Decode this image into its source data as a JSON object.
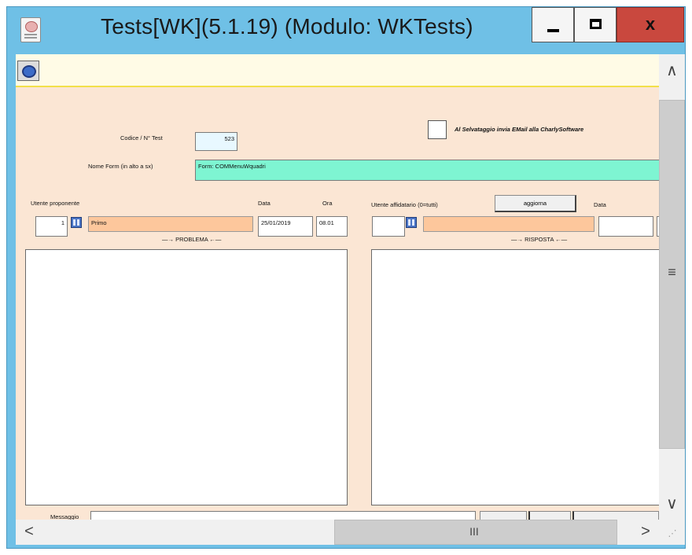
{
  "window": {
    "title": "Tests[WK](5.1.19) (Modulo: WKTests)",
    "close_glyph": "x",
    "frame_color": "#6fc0e6",
    "close_color": "#c9483e"
  },
  "form": {
    "codice_label": "Codice / N° Test",
    "codice_value": "523",
    "checkbox_label": "Al Selvataggio invia EMail alla CharlySoftware",
    "nome_form_label": "Nome Form (in alto a sx)",
    "nome_form_value": "Form: COMMenuWquadri",
    "background_color": "#fbe6d4"
  },
  "problema": {
    "utente_label": "Utente proponente",
    "data_label": "Data",
    "ora_label": "Ora",
    "utente_id": "1",
    "utente_name": "Primo",
    "data_value": "25/01/2019",
    "ora_value": "08.01",
    "section_label": "—→ PROBLEMA ←—"
  },
  "risposta": {
    "utente_label": "Utente affidatario (0=tutti)",
    "aggiorna_button": "aggiorna",
    "data_label": "Data",
    "section_label": "—→ RISPOSTA ←—"
  },
  "bottom": {
    "label": "Messaggio"
  },
  "scrollbars": {
    "up_glyph": "∧",
    "down_glyph": "∨",
    "left_glyph": "<",
    "right_glyph": ">",
    "v_grip": "≡",
    "h_grip": "III",
    "corner_glyph": "⋰"
  },
  "icons": [
    "app-icon",
    "toolbar-app-icon",
    "binoculars-icon",
    "minimize-icon",
    "maximize-icon",
    "close-icon"
  ]
}
